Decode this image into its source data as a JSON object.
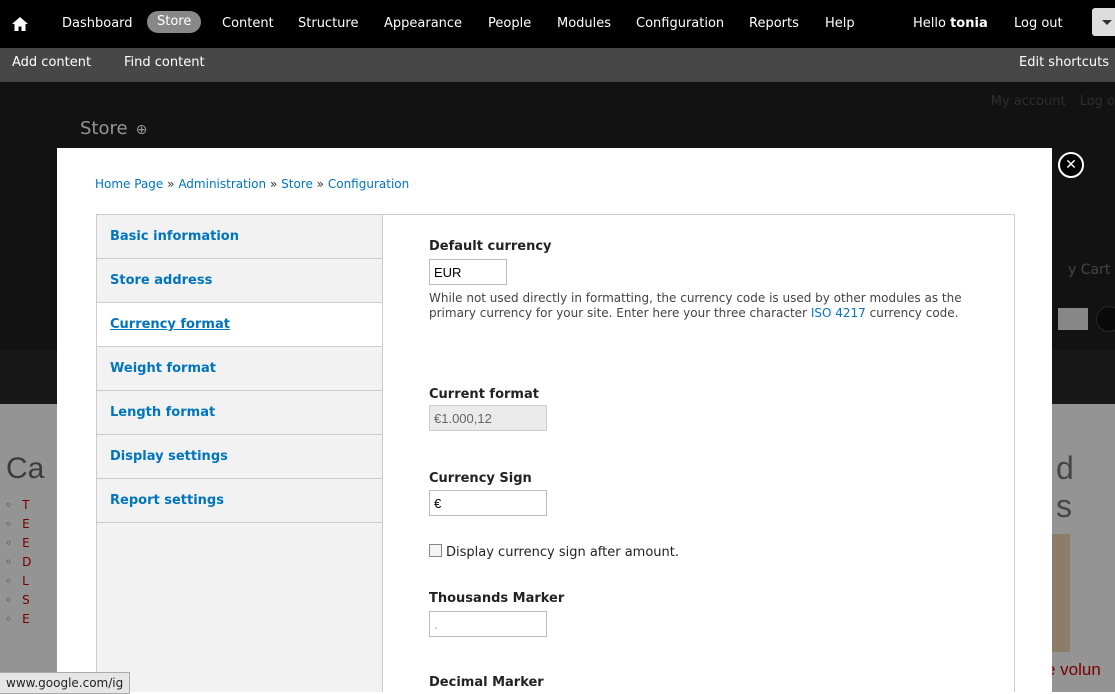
{
  "toolbar": {
    "menu": [
      {
        "label": "Dashboard"
      },
      {
        "label": "Store"
      },
      {
        "label": "Content"
      },
      {
        "label": "Structure"
      },
      {
        "label": "Appearance"
      },
      {
        "label": "People"
      },
      {
        "label": "Modules"
      },
      {
        "label": "Configuration"
      },
      {
        "label": "Reports"
      },
      {
        "label": "Help"
      }
    ],
    "hello_prefix": "Hello",
    "username": "tonia",
    "logout": "Log out",
    "shortcuts": {
      "add": "Add content",
      "find": "Find content",
      "edit": "Edit shortcuts"
    }
  },
  "background": {
    "page_title": "Store",
    "my_account": "My account",
    "log_out_partial": "Log o",
    "cart_partial": "y Cart",
    "categories_partial": "Ca",
    "list_letters": [
      "T",
      "E",
      "E",
      "D",
      "L",
      "S",
      "E"
    ],
    "right_heading_1": "d",
    "right_heading_2": "s",
    "bottom_partial": "e volun"
  },
  "modal": {
    "breadcrumb": [
      "Home Page",
      "Administration",
      "Store",
      "Configuration"
    ],
    "breadcrumb_sep": "»",
    "tabs": [
      {
        "label": "Basic information"
      },
      {
        "label": "Store address"
      },
      {
        "label": "Currency format"
      },
      {
        "label": "Weight format"
      },
      {
        "label": "Length format"
      },
      {
        "label": "Display settings"
      },
      {
        "label": "Report settings"
      }
    ],
    "selected_tab": "Currency format",
    "fields": {
      "default_currency": {
        "label": "Default currency",
        "value": "EUR",
        "desc_before": "While not used directly in formatting, the currency code is used by other modules as the primary currency for your site. Enter here your three character",
        "desc_link": "ISO 4217",
        "desc_after": "currency code."
      },
      "current_format": {
        "label": "Current format",
        "value": "€1.000,12"
      },
      "currency_sign": {
        "label": "Currency Sign",
        "value": "€"
      },
      "sign_after": {
        "label": "Display currency sign after amount.",
        "checked": false
      },
      "thousands_marker": {
        "label": "Thousands Marker",
        "value": "."
      },
      "decimal_marker": {
        "label": "Decimal Marker"
      }
    }
  },
  "status_bar": "www.google.com/ig"
}
